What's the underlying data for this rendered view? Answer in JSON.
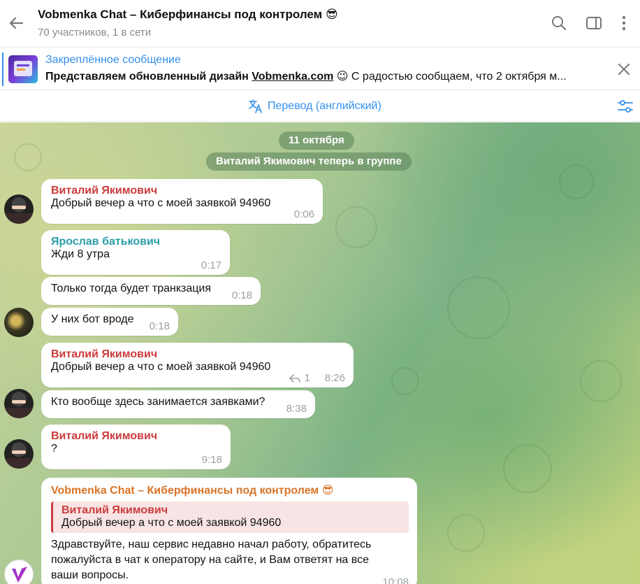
{
  "header": {
    "title": "Vobmenka Chat – Киберфинансы под контролем 😎",
    "subtitle": "70 участников, 1 в сети"
  },
  "pinned": {
    "label": "Закреплённое сообщение",
    "text_prefix": "Представляем обновленный дизайн ",
    "text_link": "Vobmenka.com",
    "text_suffix": " 😉  С радостью сообщаем, что 2 октября м..."
  },
  "translate": {
    "label": "Перевод (английский)"
  },
  "chat": {
    "date": "11 октября",
    "service": "Виталий Якимович теперь в группе",
    "messages": [
      {
        "name": "Виталий Якимович",
        "text": "Добрый вечер а что с моей заявкой 94960",
        "time": "0:06"
      },
      {
        "name": "Ярослав батькович",
        "text": "Жди 8 утра",
        "time": "0:17"
      },
      {
        "text": "Только тогда будет транкзация",
        "time": "0:18"
      },
      {
        "text": "У них бот вроде",
        "time": "0:18"
      },
      {
        "name": "Виталий Якимович",
        "text": "Добрый вечер а что с моей заявкой 94960",
        "time": "8:26",
        "replies": "1"
      },
      {
        "text": "Кто вообще здесь занимается заявками?",
        "time": "8:38"
      },
      {
        "name": "Виталий Якимович",
        "text": "?",
        "time": "9:18"
      },
      {
        "name": "Vobmenka Chat – Киберфинансы под контролем 😎",
        "quote_name": "Виталий Якимович",
        "quote_text": "Добрый вечер а что с моей заявкой 94960",
        "text_line1": "Здравствуйте, наш сервис недавно начал работу, обратитесь",
        "text_line2": "пожалуйста в чат к оператору на сайте, и Вам ответят на все",
        "text_line3": "ваши вопросы.",
        "time": "10:08"
      }
    ]
  }
}
